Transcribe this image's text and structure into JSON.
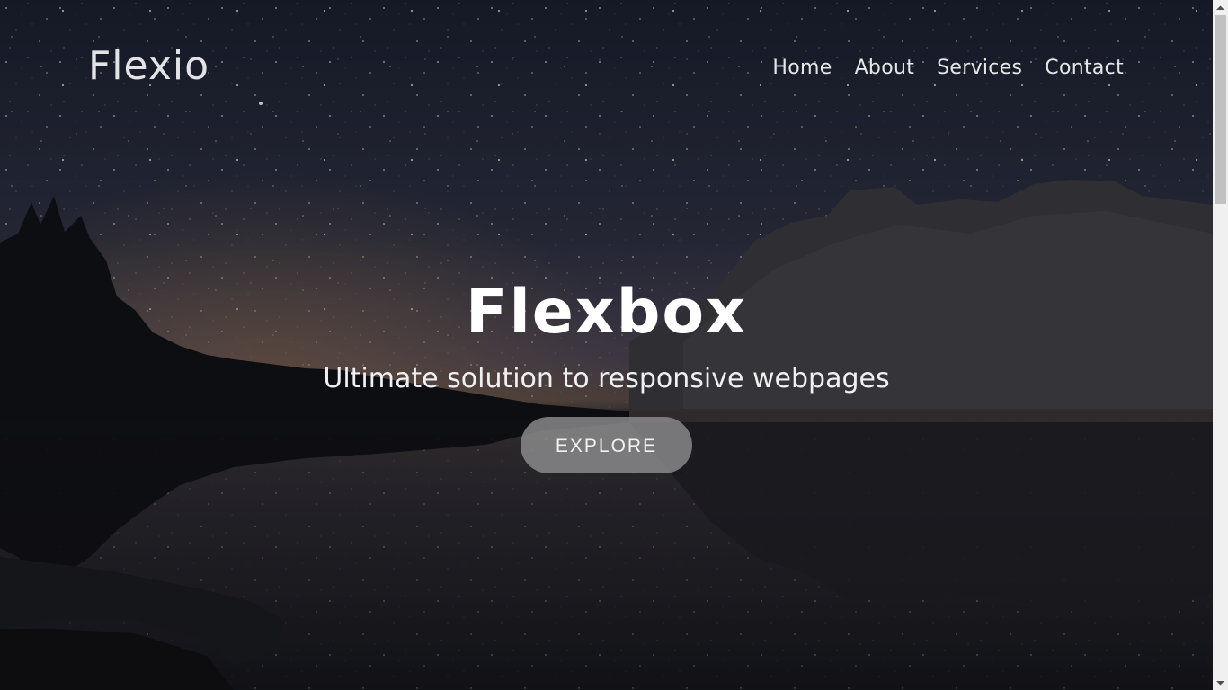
{
  "navbar": {
    "brand": "Flexio",
    "links": [
      "Home",
      "About",
      "Services",
      "Contact"
    ]
  },
  "hero": {
    "title": "Flexbox",
    "subtitle": "Ultimate solution to responsive webpages",
    "cta_label": "EXPLORE",
    "background": "night-sky-lake-mountains-image"
  },
  "colors": {
    "cta_background": "#8c8c8e",
    "text": "#ffffff",
    "sky_top": "#1b2030",
    "sky_horizon": "#4a4350"
  },
  "scrollbar": {
    "up_icon": "scroll-up-arrow-icon",
    "down_icon": "scroll-down-arrow-icon"
  }
}
